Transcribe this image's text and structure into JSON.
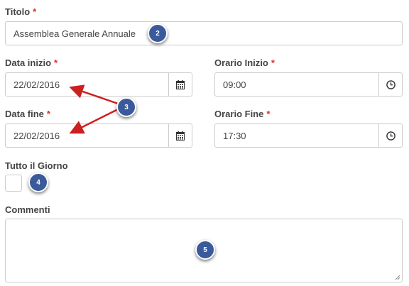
{
  "form": {
    "required_marker": "*",
    "title": {
      "label": "Titolo",
      "value": "Assemblea Generale Annuale"
    },
    "start_date": {
      "label": "Data inizio",
      "value": "22/02/2016",
      "icon": "calendar-icon"
    },
    "start_time": {
      "label": "Orario Inizio",
      "value": "09:00",
      "icon": "clock-icon"
    },
    "end_date": {
      "label": "Data fine",
      "value": "22/02/2016",
      "icon": "calendar-icon"
    },
    "end_time": {
      "label": "Orario Fine",
      "value": "17:30",
      "icon": "clock-icon"
    },
    "all_day": {
      "label": "Tutto il Giorno",
      "checked": false
    },
    "comments": {
      "label": "Commenti",
      "value": ""
    }
  },
  "annotations": {
    "badge_title": "2",
    "badge_dates": "3",
    "badge_all_day": "4",
    "badge_comments": "5",
    "badge_color": "#3a5a9b",
    "arrow_color": "#cc1f1f"
  },
  "colors": {
    "required": "#d9302c",
    "border": "#cccccc",
    "label": "#444444"
  }
}
